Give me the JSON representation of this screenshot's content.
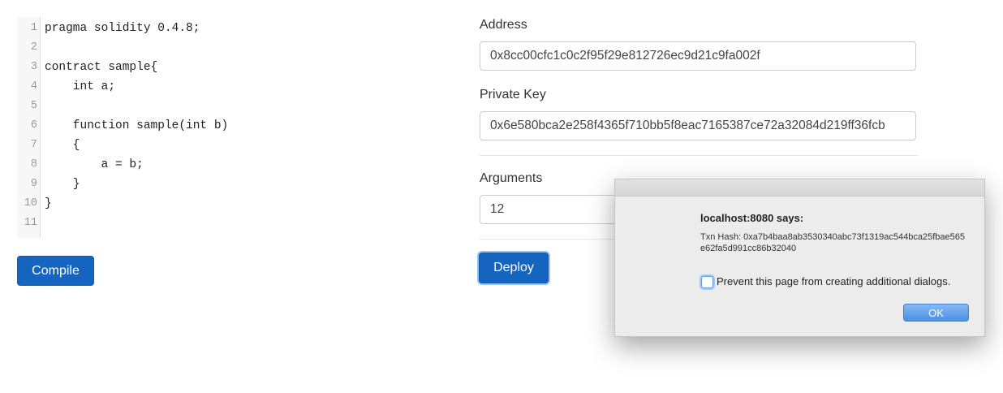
{
  "editor": {
    "lines": [
      {
        "num": "1",
        "text": "pragma solidity 0.4.8;"
      },
      {
        "num": "2",
        "text": ""
      },
      {
        "num": "3",
        "text": "contract sample{"
      },
      {
        "num": "4",
        "text": "    int a;"
      },
      {
        "num": "5",
        "text": ""
      },
      {
        "num": "6",
        "text": "    function sample(int b)"
      },
      {
        "num": "7",
        "text": "    {"
      },
      {
        "num": "8",
        "text": "        a = b;"
      },
      {
        "num": "9",
        "text": "    }"
      },
      {
        "num": "10",
        "text": "}"
      },
      {
        "num": "11",
        "text": ""
      }
    ]
  },
  "compile_button": "Compile",
  "form": {
    "address_label": "Address",
    "address_value": "0x8cc00cfc1c0c2f95f29e812726ec9d21c9fa002f",
    "private_key_label": "Private Key",
    "private_key_value": "0x6e580bca2e258f4365f710bb5f8eac7165387ce72a32084d219ff36fcb",
    "arguments_label": "Arguments",
    "arguments_value": "12",
    "deploy_button": "Deploy"
  },
  "dialog": {
    "title": "localhost:8080 says:",
    "message": "Txn Hash: 0xa7b4baa8ab3530340abc73f1319ac544bca25fbae565e62fa5d991cc86b32040",
    "checkbox_label": "Prevent this page from creating additional dialogs.",
    "ok_button": "OK"
  }
}
